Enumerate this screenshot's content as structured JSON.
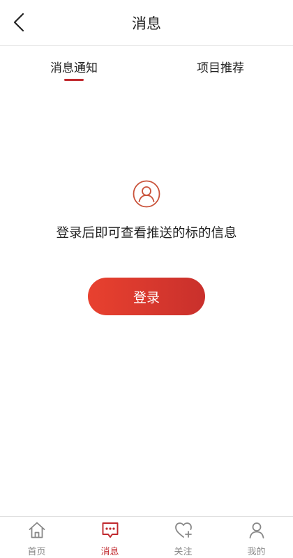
{
  "header": {
    "title": "消息",
    "back_icon": "chevron-left-icon"
  },
  "tabs": [
    {
      "label": "消息通知",
      "active": true
    },
    {
      "label": "项目推荐",
      "active": false
    }
  ],
  "empty_state": {
    "icon": "user-circle-icon",
    "message": "登录后即可查看推送的标的信息"
  },
  "login_button": {
    "label": "登录"
  },
  "tabbar": [
    {
      "label": "首页",
      "icon": "home-icon",
      "active": false
    },
    {
      "label": "消息",
      "icon": "message-icon",
      "active": true
    },
    {
      "label": "关注",
      "icon": "heart-plus-icon",
      "active": false
    },
    {
      "label": "我的",
      "icon": "person-icon",
      "active": false
    }
  ],
  "colors": {
    "accent": "#c0282d",
    "button_gradient_start": "#e8412f",
    "button_gradient_end": "#c9302c",
    "icon_outline": "#c9523a",
    "inactive": "#888888"
  }
}
